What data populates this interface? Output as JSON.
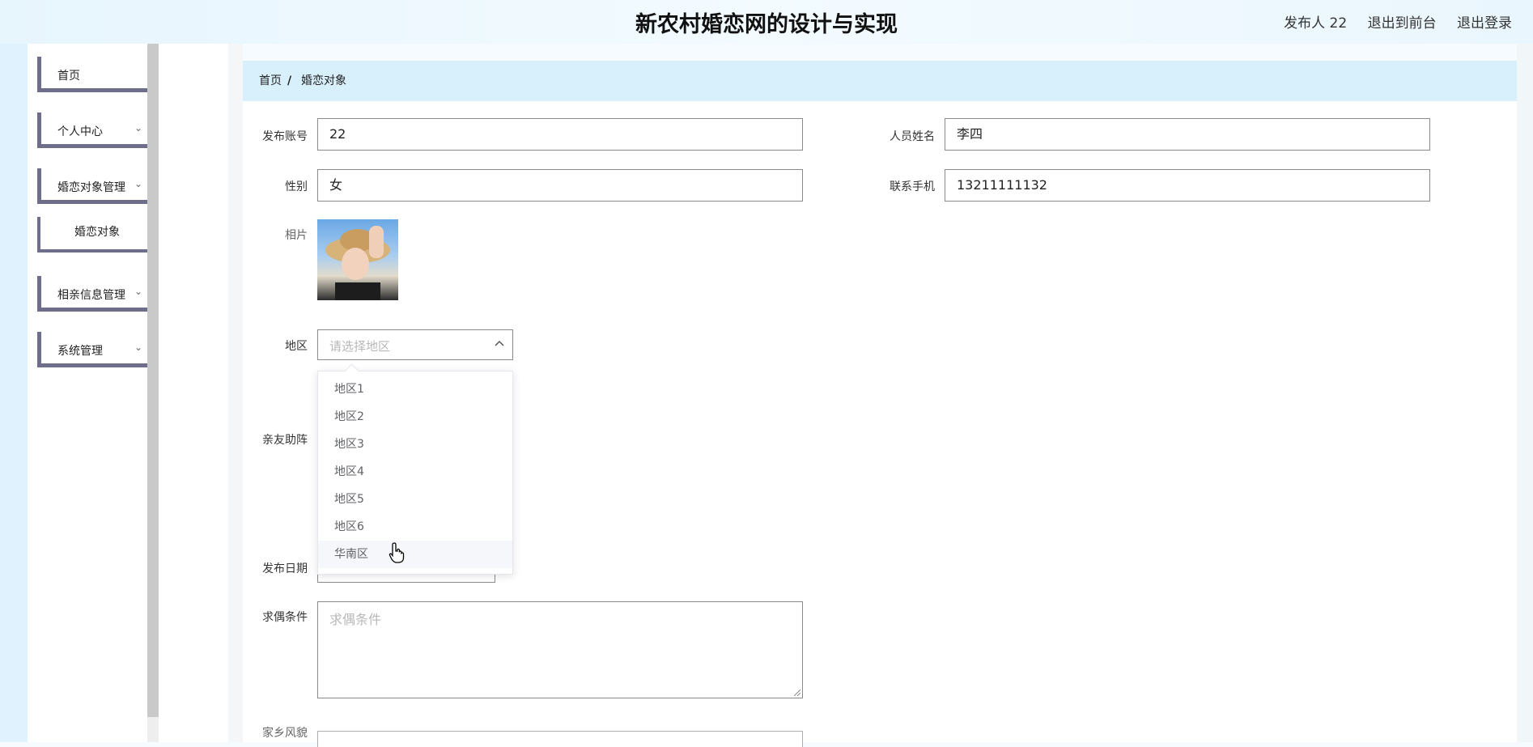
{
  "header": {
    "title": "新农村婚恋网的设计与实现",
    "user_label": "发布人 22",
    "to_frontend": "退出到前台",
    "logout": "退出登录"
  },
  "sidebar": {
    "items": [
      {
        "label": "首页",
        "has_children": false
      },
      {
        "label": "个人中心",
        "has_children": true
      },
      {
        "label": "婚恋对象管理",
        "has_children": true
      },
      {
        "label": "婚恋对象",
        "is_sub": true
      },
      {
        "label": "相亲信息管理",
        "has_children": true
      },
      {
        "label": "系统管理",
        "has_children": true
      }
    ]
  },
  "breadcrumb": {
    "home": "首页",
    "separator": "/",
    "current": "婚恋对象"
  },
  "form": {
    "account_label": "发布账号",
    "account_value": "22",
    "name_label": "人员姓名",
    "name_value": "李四",
    "gender_label": "性别",
    "gender_value": "女",
    "phone_label": "联系手机",
    "phone_value": "13211111132",
    "photo_label": "相片",
    "region_label": "地区",
    "region_placeholder": "请选择地区",
    "region_options": [
      "地区1",
      "地区2",
      "地区3",
      "地区4",
      "地区5",
      "地区6",
      "华南区"
    ],
    "region_hovered_index": 6,
    "friends_label": "亲友助阵",
    "date_label": "发布日期",
    "requirement_label": "求偶条件",
    "requirement_placeholder": "求偶条件",
    "hometown_label": "家乡风貌"
  },
  "colors": {
    "breadcrumb_bg": "#d8effc",
    "menu_border": "#6e6e8a",
    "header_bg": "#eaf6fd"
  }
}
